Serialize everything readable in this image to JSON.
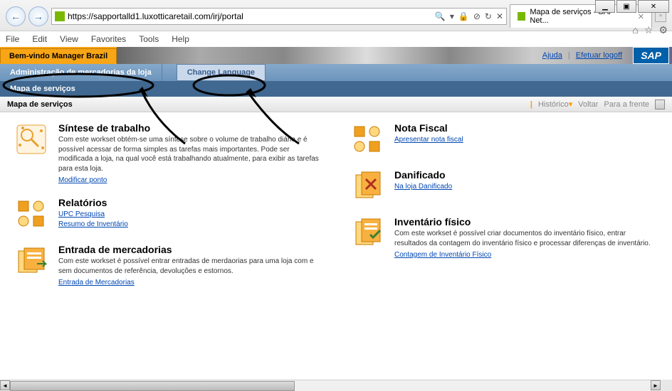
{
  "window": {
    "min": "▁",
    "max": "▣",
    "close": "✕"
  },
  "browser": {
    "url": "https://sapportalld1.luxotticaretail.com/irj/portal",
    "search_icon": "🔍",
    "lock_icon": "🔒",
    "tab_title": "Mapa de serviços - SAP Net...",
    "tab_close": "✕",
    "menu": {
      "file": "File",
      "edit": "Edit",
      "view": "View",
      "favorites": "Favorites",
      "tools": "Tools",
      "help": "Help"
    },
    "icons": {
      "home": "⌂",
      "star": "☆",
      "gear": "⚙"
    }
  },
  "portal": {
    "welcome": "Bem-vindo Manager Brazil",
    "links": {
      "ajuda": "Ajuda",
      "logoff": "Efetuar logoff"
    },
    "sap_logo": "SAP"
  },
  "nav": {
    "tab1": "Administração de mercadorias da loja",
    "tab2": "Change Language",
    "sub1": "Mapa de serviços"
  },
  "breadcrumb": {
    "title": "Mapa de serviços",
    "historico": "Histórico",
    "voltar": "Voltar",
    "frente": "Para a frente"
  },
  "worksets": {
    "sintese": {
      "title": "Síntese de trabalho",
      "desc": "Com este workset obtém-se uma síntese sobre o volume de trabalho diário e é possível acessar de forma simples as tarefas mais importantes. Pode ser modificada a loja, na qual você está trabalhando atualmente, para exibir as tarefas para esta loja.",
      "link1": "Modificar ponto"
    },
    "relatorios": {
      "title": "Relatórios",
      "link1": "UPC Pesquisa",
      "link2": "Resumo de Inventário"
    },
    "entrada": {
      "title": "Entrada de mercadorias",
      "desc": "Com este workset é possível entrar entradas de merdaorias para uma loja com e sem documentos de referência, devoluções e estornos.",
      "link1": "Entrada de Mercadorias"
    },
    "nota": {
      "title": "Nota Fiscal",
      "link1": "Apresentar nota fiscal"
    },
    "danificado": {
      "title": "Danificado",
      "link1": "Na loja Danificado"
    },
    "inventario": {
      "title": "Inventário físico",
      "desc": "Com este workset é possível criar documentos do inventário físico, entrar resultados da contagem do inventário físico e processar diferenças de inventário.",
      "link1": "Contagem de Inventário Físico"
    }
  }
}
